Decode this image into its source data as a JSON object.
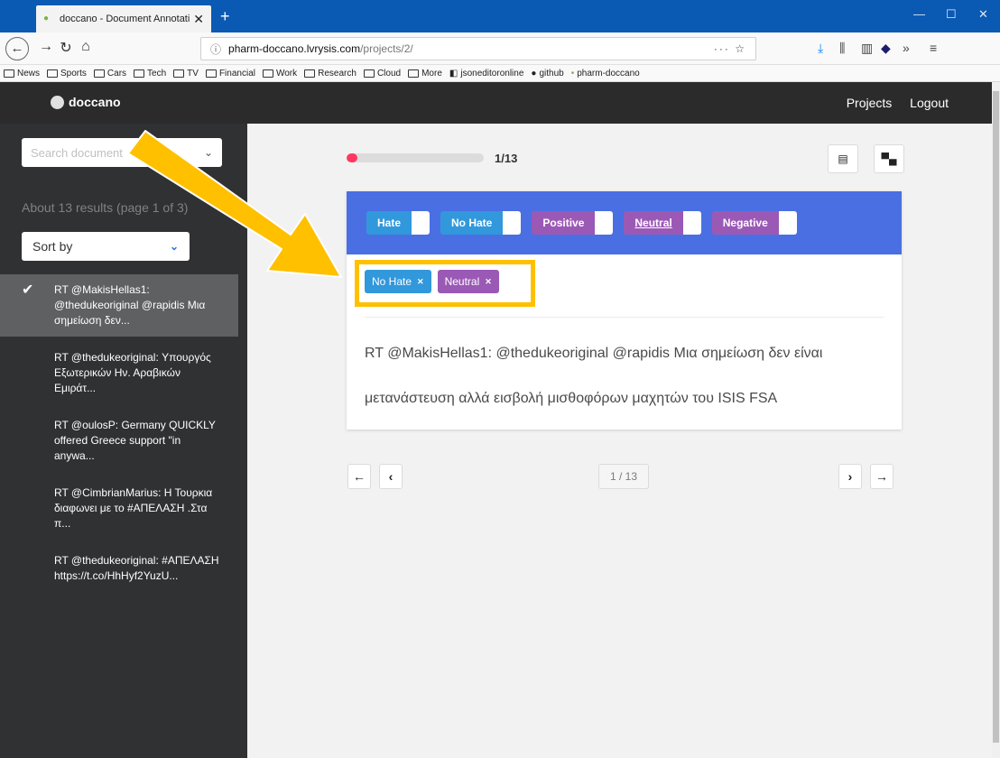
{
  "browser": {
    "tab_title": "doccano - Document Annotati",
    "new_tab": "+",
    "url_domain": "pharm-doccano.lvrysis.com",
    "url_path": "/projects/2/",
    "url_actions": "··· ☆",
    "bookmarks": [
      "News",
      "Sports",
      "Cars",
      "Tech",
      "TV",
      "Financial",
      "Work",
      "Research",
      "Cloud",
      "More",
      "jsoneditoronline",
      "github",
      "pharm-doccano"
    ]
  },
  "app": {
    "brand": "doccano",
    "nav": [
      "Projects",
      "Logout"
    ]
  },
  "sidebar": {
    "search_placeholder": "Search document",
    "results_text": "About 13 results (page 1 of 3)",
    "sort_label": "Sort by",
    "documents": [
      {
        "text": "RT @MakisHellas1: @thedukeoriginal @rapidis Μια σημείωση δεν...",
        "active": true
      },
      {
        "text": "RT @thedukeoriginal: Υπουργός Εξωτερικών Ην. Αραβικών Εμιράτ...",
        "active": false
      },
      {
        "text": "RT @oulosP: Germany QUICKLY offered Greece support \"in anywa...",
        "active": false
      },
      {
        "text": "RT @CimbrianMarius: Η Τουρκια διαφωνει με το #ΑΠΕΛΑΣΗ .Στα π...",
        "active": false
      },
      {
        "text": "RT @thedukeoriginal: #ΑΠΕΛΑΣΗ https://t.co/HhHyf2YuzU...",
        "active": false
      }
    ]
  },
  "main": {
    "progress": {
      "fraction": 0.077,
      "text": "1/13"
    },
    "labels": [
      {
        "name": "Hate",
        "color": "#3298dc"
      },
      {
        "name": "No Hate",
        "color": "#3298dc"
      },
      {
        "name": "Positive",
        "color": "#9b59b6"
      },
      {
        "name": "Neutral",
        "color": "#9b59b6"
      },
      {
        "name": "Negative",
        "color": "#9b59b6"
      }
    ],
    "assigned": [
      {
        "name": "No Hate",
        "color": "#3298dc"
      },
      {
        "name": "Neutral",
        "color": "#9b59b6"
      }
    ],
    "document_text": "RT @MakisHellas1: @thedukeoriginal @rapidis Μια σημείωση δεν είναι μετανάστευση αλλά εισβολή μισθοφόρων μαχητών του ISIS FSA",
    "pagination": "1 / 13"
  },
  "annotation": {
    "highlight_color": "#ffc000"
  }
}
